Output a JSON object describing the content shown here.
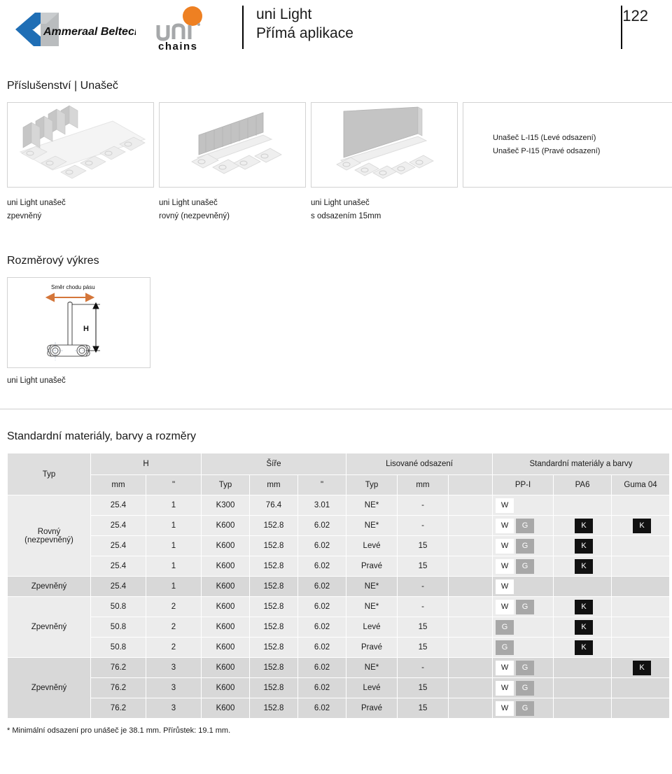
{
  "header": {
    "brand_left": "Ammeraal Beltech",
    "brand_right_top": "uni",
    "brand_right_bottom": "chains",
    "title_line1": "uni Light",
    "title_line2": "Přímá aplikace",
    "page_number": "122"
  },
  "accessory": {
    "heading": "Příslušenství | Unašeč",
    "items": [
      {
        "caption_line1": "uni Light unašeč",
        "caption_line2": "zpevněný"
      },
      {
        "caption_line1": "uni Light unašeč",
        "caption_line2": "rovný (nezpevněný)"
      },
      {
        "caption_line1": "uni Light unašeč",
        "caption_line2": "s odsazením 15mm"
      }
    ],
    "text_panel": {
      "line1": "Unašeč L-I15 (Levé odsazení)",
      "line2": "Unašeč P-I15 (Pravé odsazení)"
    }
  },
  "drawing": {
    "heading": "Rozměrový výkres",
    "direction_label": "Směr chodu pásu",
    "height_label": "H",
    "caption": "uni Light unašeč",
    "arrow_color": "#d4763a"
  },
  "table": {
    "heading": "Standardní materiály, barvy a rozměry",
    "group_headers": {
      "typ": "Typ",
      "h": "H",
      "sire": "Šíře",
      "odsazeni": "Lisované odsazení",
      "materialy": "Standardní materiály a barvy"
    },
    "sub_headers": {
      "h_mm": "mm",
      "h_in": "\"",
      "sire_typ": "Typ",
      "sire_mm": "mm",
      "sire_in": "\"",
      "ods_typ": "Typ",
      "ods_mm": "mm",
      "ods_blank": "",
      "ppi": "PP-I",
      "pa6": "PA6",
      "guma": "Guma 04"
    },
    "groups": [
      {
        "label": "Rovný\n(nezpevněný)",
        "label_line1": "Rovný",
        "label_line2": "(nezpevněný)",
        "shade": "light",
        "rows": [
          {
            "h_mm": "25.4",
            "h_in": "1",
            "sire_typ": "K300",
            "sire_mm": "76.4",
            "sire_in": "3.01",
            "ods_typ": "NE*",
            "ods_mm": "-",
            "ppi": [
              "W"
            ],
            "pa6": [],
            "guma": []
          },
          {
            "h_mm": "25.4",
            "h_in": "1",
            "sire_typ": "K600",
            "sire_mm": "152.8",
            "sire_in": "6.02",
            "ods_typ": "NE*",
            "ods_mm": "-",
            "ppi": [
              "W",
              "G"
            ],
            "pa6": [
              "K"
            ],
            "guma": [
              "K"
            ]
          },
          {
            "h_mm": "25.4",
            "h_in": "1",
            "sire_typ": "K600",
            "sire_mm": "152.8",
            "sire_in": "6.02",
            "ods_typ": "Levé",
            "ods_mm": "15",
            "ppi": [
              "W",
              "G"
            ],
            "pa6": [
              "K"
            ],
            "guma": []
          },
          {
            "h_mm": "25.4",
            "h_in": "1",
            "sire_typ": "K600",
            "sire_mm": "152.8",
            "sire_in": "6.02",
            "ods_typ": "Pravé",
            "ods_mm": "15",
            "ppi": [
              "W",
              "G"
            ],
            "pa6": [
              "K"
            ],
            "guma": []
          }
        ]
      },
      {
        "label_line1": "Zpevněný",
        "label_line2": "",
        "shade": "dark",
        "rows": [
          {
            "h_mm": "25.4",
            "h_in": "1",
            "sire_typ": "K600",
            "sire_mm": "152.8",
            "sire_in": "6.02",
            "ods_typ": "NE*",
            "ods_mm": "-",
            "ppi": [
              "W"
            ],
            "pa6": [],
            "guma": []
          }
        ]
      },
      {
        "label_line1": "Zpevněný",
        "label_line2": "",
        "shade": "light",
        "rows": [
          {
            "h_mm": "50.8",
            "h_in": "2",
            "sire_typ": "K600",
            "sire_mm": "152.8",
            "sire_in": "6.02",
            "ods_typ": "NE*",
            "ods_mm": "-",
            "ppi": [
              "W",
              "G"
            ],
            "pa6": [
              "K"
            ],
            "guma": []
          },
          {
            "h_mm": "50.8",
            "h_in": "2",
            "sire_typ": "K600",
            "sire_mm": "152.8",
            "sire_in": "6.02",
            "ods_typ": "Levé",
            "ods_mm": "15",
            "ppi": [
              "G"
            ],
            "pa6": [
              "K"
            ],
            "guma": []
          },
          {
            "h_mm": "50.8",
            "h_in": "2",
            "sire_typ": "K600",
            "sire_mm": "152.8",
            "sire_in": "6.02",
            "ods_typ": "Pravé",
            "ods_mm": "15",
            "ppi": [
              "G"
            ],
            "pa6": [
              "K"
            ],
            "guma": []
          }
        ]
      },
      {
        "label_line1": "Zpevněný",
        "label_line2": "",
        "shade": "dark",
        "rows": [
          {
            "h_mm": "76.2",
            "h_in": "3",
            "sire_typ": "K600",
            "sire_mm": "152.8",
            "sire_in": "6.02",
            "ods_typ": "NE*",
            "ods_mm": "-",
            "ppi": [
              "W",
              "G"
            ],
            "pa6": [],
            "guma": [
              "K"
            ]
          },
          {
            "h_mm": "76.2",
            "h_in": "3",
            "sire_typ": "K600",
            "sire_mm": "152.8",
            "sire_in": "6.02",
            "ods_typ": "Levé",
            "ods_mm": "15",
            "ppi": [
              "W",
              "G"
            ],
            "pa6": [],
            "guma": []
          },
          {
            "h_mm": "76.2",
            "h_in": "3",
            "sire_typ": "K600",
            "sire_mm": "152.8",
            "sire_in": "6.02",
            "ods_typ": "Pravé",
            "ods_mm": "15",
            "ppi": [
              "W",
              "G"
            ],
            "pa6": [],
            "guma": []
          }
        ]
      }
    ],
    "footnote": "* Minimální odsazení pro unášeč je 38.1 mm. Přírůstek: 19.1 mm.",
    "colors": {
      "chip_white": "#ffffff",
      "chip_gray": "#a8a8a8",
      "chip_black": "#111111",
      "header_bg": "#dedede",
      "row_light": "#ececec",
      "row_dark": "#d8d8d8"
    }
  }
}
